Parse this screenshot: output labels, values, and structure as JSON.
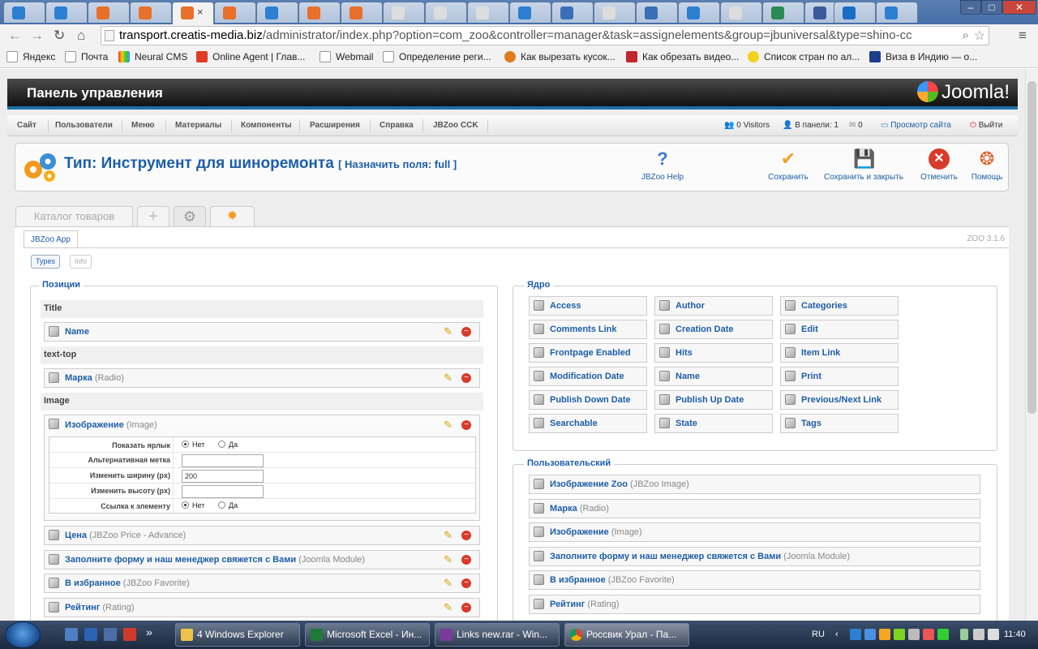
{
  "browser": {
    "active_tab_close": "×",
    "url_host": "transport.creatis-media.biz",
    "url_path": "/administrator/index.php?option=com_zoo&controller=manager&task=assignelements&group=jbuniversal&type=shino-cc",
    "window_buttons": {
      "minimize": "–",
      "maximize": "□",
      "close": "✕"
    }
  },
  "bookmarks": [
    {
      "label": "Яндекс",
      "color": "#ffffff"
    },
    {
      "label": "Почта",
      "color": "#ffffff"
    },
    {
      "label": "Neural CMS",
      "color": "#e94b3c"
    },
    {
      "label": "Online Agent | Глав...",
      "color": "#e23d24"
    },
    {
      "label": "Webmail",
      "color": "#ffffff"
    },
    {
      "label": "Определение реги...",
      "color": "#ffffff"
    },
    {
      "label": "Как вырезать кусок...",
      "color": "#e07a1f"
    },
    {
      "label": "Как обрезать видео...",
      "color": "#c1272d"
    },
    {
      "label": "Список стран по ал...",
      "color": "#f4d21b"
    },
    {
      "label": "Виза в Индию — о...",
      "color": "#1d3e8a"
    }
  ],
  "header": {
    "title": "Панель управления",
    "logo": "Joomla!"
  },
  "menu": [
    "Сайт",
    "Пользователи",
    "Меню",
    "Материалы",
    "Компоненты",
    "Расширения",
    "Справка",
    "JBZoo CCK"
  ],
  "status": {
    "visitors": "0 Visitors",
    "in_panel": "В панели: 1",
    "messages": "0",
    "view_site": "Просмотр сайта",
    "logout": "Выйти"
  },
  "toolbar": {
    "title": "Тип: Инструмент для шиноремонта",
    "subtitle": "[ Назначить поля: full ]",
    "help_label": "JBZoo Help",
    "save": "Сохранить",
    "save_close": "Сохранить и закрыть",
    "cancel": "Отменить",
    "assist": "Помощь"
  },
  "tabs": {
    "catalog": "Каталог товаров",
    "app": "JBZoo App",
    "version": "ZOO 3.1.6",
    "types": "Types",
    "info": "Info"
  },
  "positions": {
    "legend": "Позиции",
    "title_head": "Title",
    "texttop_head": "text-top",
    "image_head": "Image",
    "name": "Name",
    "marka": "Марка",
    "marka_type": "(Radio)",
    "image": "Изображение",
    "image_type": "(Image)",
    "cfg": {
      "show_label": "Показать ярлык",
      "alt": "Альтернативная метка",
      "width": "Изменить ширину (px)",
      "width_value": "200",
      "height": "Изменить высоту (px)",
      "link": "Ссылка к элементу",
      "no": "Нет",
      "yes": "Да"
    },
    "price": "Цена",
    "price_type": "(JBZoo Price - Advance)",
    "form": "Заполните форму и наш менеджер свяжется с Вами",
    "form_type": "(Joomla Module)",
    "fav": "В избранное",
    "fav_type": "(JBZoo Favorite)",
    "rating": "Рейтинг",
    "rating_type": "(Rating)"
  },
  "core": {
    "legend": "Ядро",
    "items": [
      "Access",
      "Author",
      "Categories",
      "Comments Link",
      "Creation Date",
      "Edit",
      "Frontpage Enabled",
      "Hits",
      "Item Link",
      "Modification Date",
      "Name",
      "Print",
      "Publish Down Date",
      "Publish Up Date",
      "Previous/Next Link",
      "Searchable",
      "State",
      "Tags"
    ]
  },
  "custom": {
    "legend": "Пользовательский",
    "items": [
      {
        "name": "Изображение Zoo",
        "type": "(JBZoo Image)"
      },
      {
        "name": "Марка",
        "type": "(Radio)"
      },
      {
        "name": "Изображение",
        "type": "(Image)"
      },
      {
        "name": "Заполните форму и наш менеджер свяжется с Вами",
        "type": "(Joomla Module)"
      },
      {
        "name": "В избранное",
        "type": "(JBZoo Favorite)"
      },
      {
        "name": "Рейтинг",
        "type": "(Rating)"
      }
    ]
  },
  "taskbar": {
    "windows": [
      "4 Windows Explorer",
      "Microsoft Excel - Ин...",
      "Links new.rar - Win...",
      "Россвик Урал - Па..."
    ],
    "lang": "RU",
    "clock": "11:40",
    "overflow": "»"
  }
}
